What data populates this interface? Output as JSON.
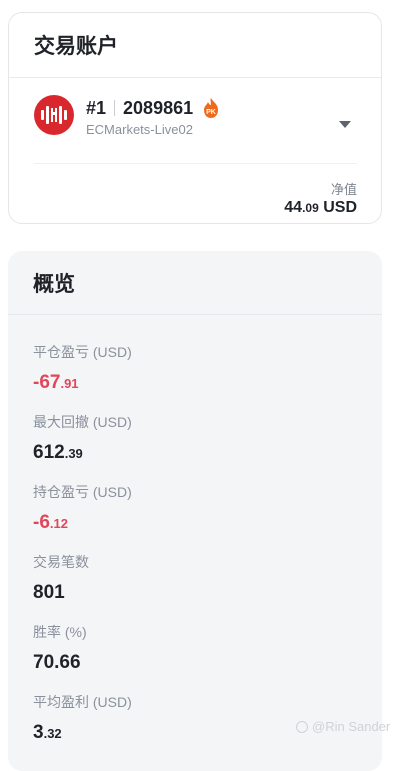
{
  "account_card": {
    "title": "交易账户",
    "account_index": "#1",
    "account_number": "2089861",
    "badge": "PK",
    "server": "ECMarkets-Live02",
    "equity_label": "净值",
    "equity_int": "44",
    "equity_dec": ".09",
    "equity_unit": "USD"
  },
  "overview": {
    "title": "概览",
    "stats": [
      {
        "label": "平仓盈亏 (USD)",
        "int": "-67",
        "dec": ".91",
        "negative": true
      },
      {
        "label": "最大回撤 (USD)",
        "int": "612",
        "dec": ".39",
        "negative": false
      },
      {
        "label": "持仓盈亏 (USD)",
        "int": "-6",
        "dec": ".12",
        "negative": true
      },
      {
        "label": "交易笔数",
        "int": "801",
        "dec": "",
        "negative": false
      },
      {
        "label": "胜率 (%)",
        "int": "70.66",
        "dec": "",
        "negative": false
      },
      {
        "label": "平均盈利 (USD)",
        "int": "3",
        "dec": ".32",
        "negative": false
      }
    ]
  },
  "watermark": "@Rin Sander",
  "colors": {
    "negative": "#e0475a",
    "logo_red": "#d9272e",
    "pk_orange": "#f06a1a"
  }
}
